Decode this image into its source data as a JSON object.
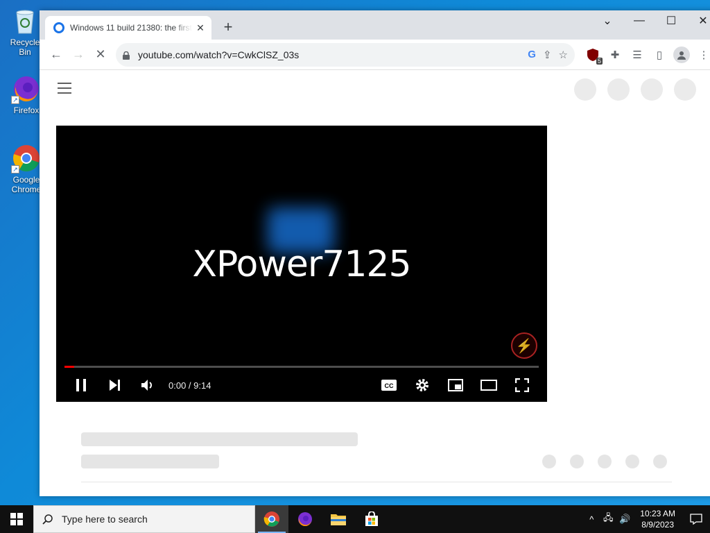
{
  "desktop": {
    "icons": [
      {
        "label": "Recycle Bin",
        "icon": "recycle-bin-icon"
      },
      {
        "label": "Firefox",
        "icon": "firefox-icon"
      },
      {
        "label": "Google Chrome",
        "icon": "chrome-icon"
      }
    ]
  },
  "browser": {
    "tab": {
      "title": "Windows 11 build 21380: the first",
      "close": "✕"
    },
    "new_tab": "+",
    "window_controls": {
      "dropdown": "⌄",
      "minimize": "—",
      "maximize": "☐",
      "close": "✕"
    },
    "toolbar": {
      "back": "←",
      "forward": "→",
      "stop": "✕",
      "url": "youtube.com/watch?v=CwkClSZ_03s",
      "google_lens": "G",
      "share": "⇪",
      "bookmark": "☆",
      "extension_badge": "5",
      "extensions": "✚",
      "reading_list": "☰",
      "side_panel": "▯",
      "profile": "●",
      "menu": "⋮"
    }
  },
  "video": {
    "overlay_text": "XPower7125",
    "time": "0:00 / 9:14",
    "progress_fraction": 0.02,
    "accent_color": "#ff0000"
  },
  "taskbar": {
    "search_placeholder": "Type here to search",
    "time": "10:23 AM",
    "date": "8/9/2023",
    "tray": {
      "chevron": "^",
      "network": "🖧",
      "volume": "🔊"
    }
  }
}
